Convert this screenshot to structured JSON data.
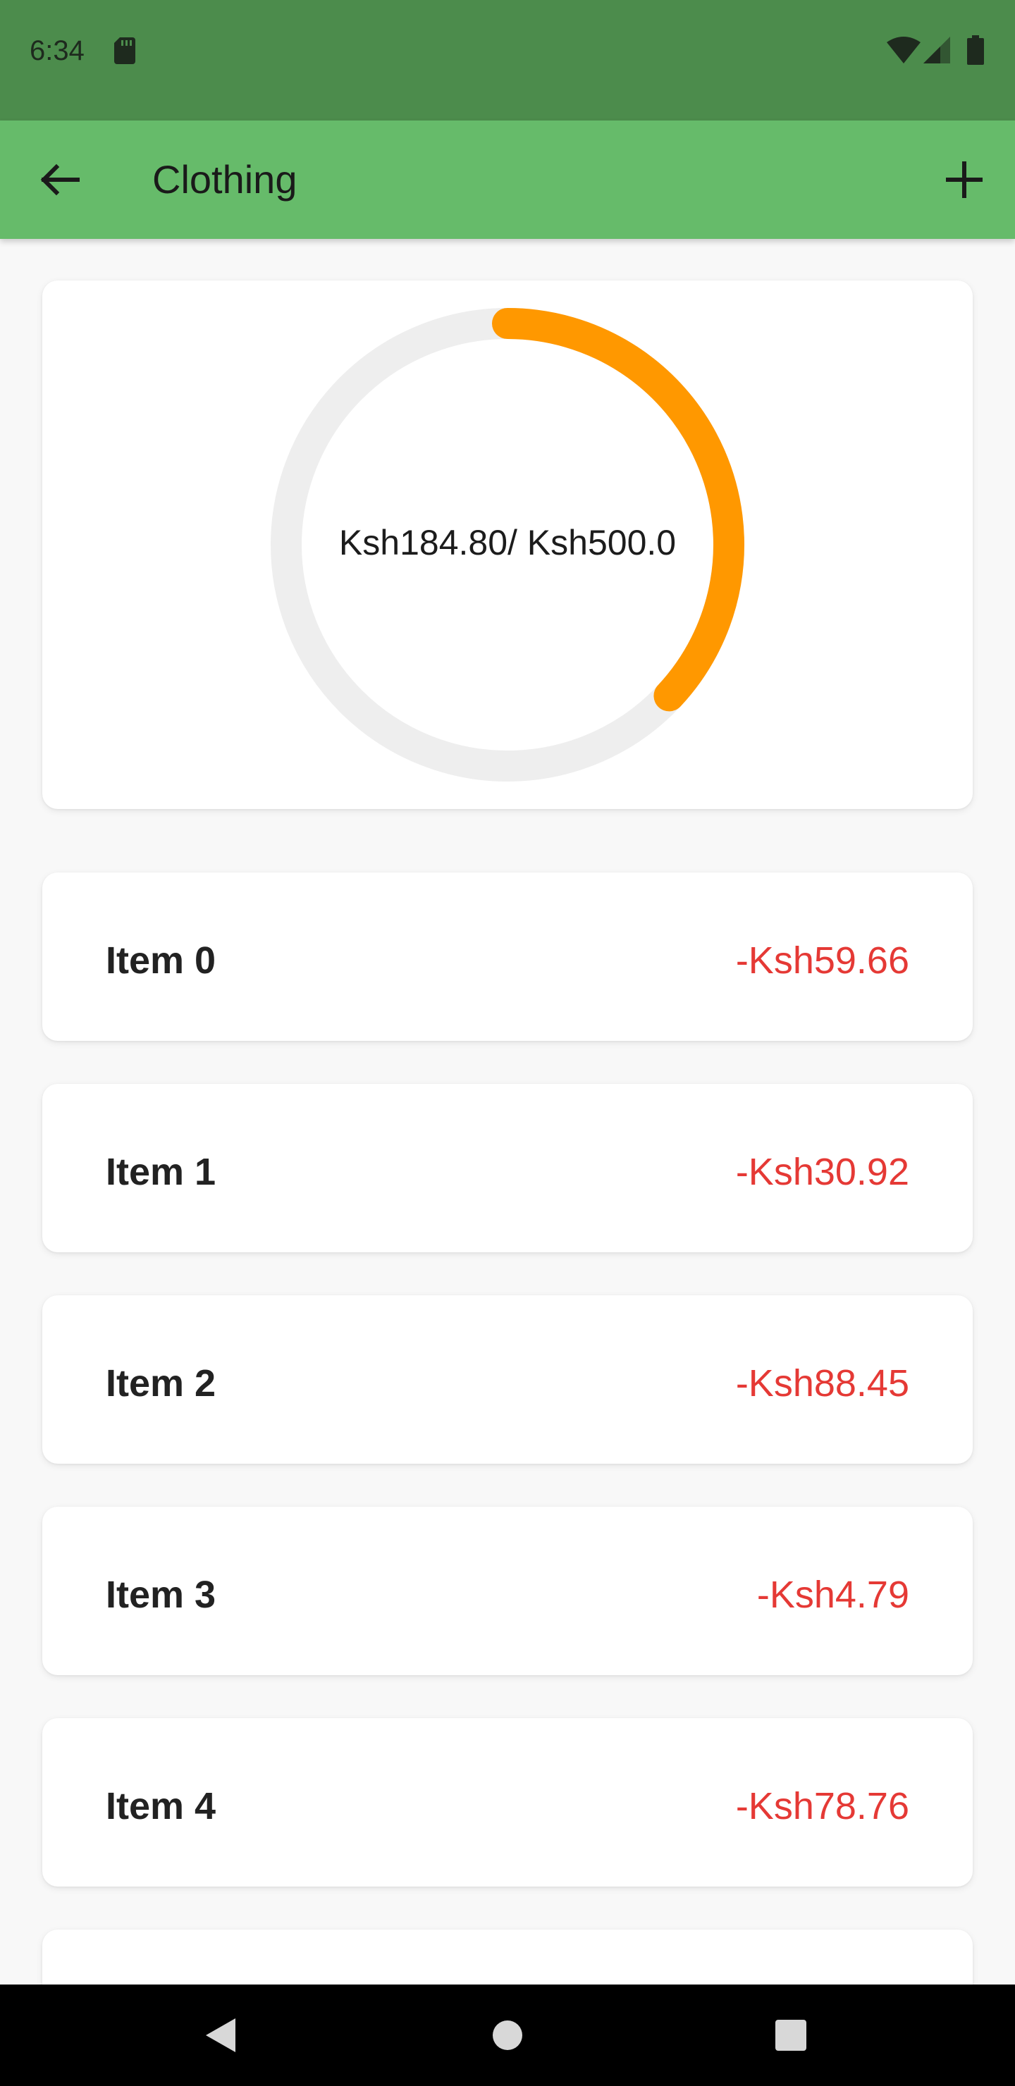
{
  "status_bar": {
    "time": "6:34",
    "icons": [
      "sd-card-icon",
      "wifi-icon",
      "cell-signal-icon",
      "battery-icon"
    ]
  },
  "app_bar": {
    "title": "Clothing",
    "back_icon": "arrow-back-icon",
    "action_icon": "add-icon"
  },
  "budget": {
    "label": "Ksh184.80/ Ksh500.0",
    "spent": 184.8,
    "limit": 500.0,
    "progress_fraction": 0.3696,
    "track_color": "#eeeeee",
    "progress_color": "#ff9800"
  },
  "items": [
    {
      "name": "Item 0",
      "amount": "-Ksh59.66"
    },
    {
      "name": "Item 1",
      "amount": "-Ksh30.92"
    },
    {
      "name": "Item 2",
      "amount": "-Ksh88.45"
    },
    {
      "name": "Item 3",
      "amount": "-Ksh4.79"
    },
    {
      "name": "Item 4",
      "amount": "-Ksh78.76"
    }
  ],
  "colors": {
    "status_bar": "#4c8c4c",
    "app_bar": "#66bb6a",
    "amount": "#e53935",
    "background": "#f8f8f8"
  },
  "nav_bar": {
    "icons": [
      "nav-back-icon",
      "nav-home-icon",
      "nav-recents-icon"
    ]
  }
}
